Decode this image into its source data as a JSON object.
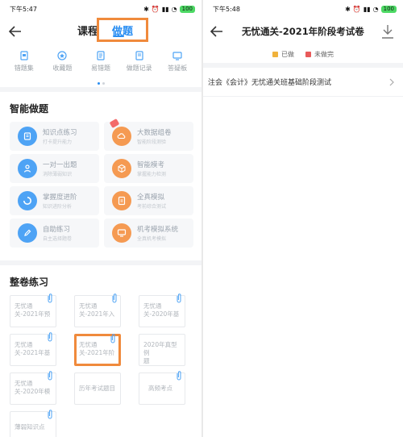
{
  "left": {
    "status": {
      "time": "下午5:47",
      "battery": "100"
    },
    "header": {
      "course_tab": "课程",
      "practice_tab": "做题"
    },
    "quick_items": [
      {
        "label": "错题集",
        "icon": "notebook-icon"
      },
      {
        "label": "收藏题",
        "icon": "star-icon"
      },
      {
        "label": "易错题",
        "icon": "document-icon"
      },
      {
        "label": "做题记录",
        "icon": "record-icon"
      },
      {
        "label": "答疑板",
        "icon": "board-icon"
      }
    ],
    "smart_section": {
      "title": "智能做题",
      "cards": [
        {
          "title": "知识点练习",
          "sub": "打卡提升能力",
          "color": "blue",
          "icon": "book-icon"
        },
        {
          "title": "大数据组卷",
          "sub": "智能阶段测验",
          "color": "orange",
          "icon": "cloud-icon"
        },
        {
          "title": "一对一出题",
          "sub": "消除薄弱知识",
          "color": "blue",
          "icon": "person-icon"
        },
        {
          "title": "智能模考",
          "sub": "掌握能力检测",
          "color": "orange",
          "icon": "cube-icon"
        },
        {
          "title": "掌握度进阶",
          "sub": "知识进阶分析",
          "color": "blue",
          "icon": "progress-icon"
        },
        {
          "title": "全真模拟",
          "sub": "考前综合测试",
          "color": "orange",
          "icon": "paper-icon"
        },
        {
          "title": "自助练习",
          "sub": "自主选择题卷",
          "color": "blue",
          "icon": "pencil-icon"
        },
        {
          "title": "机考模拟系统",
          "sub": "全真机考模拟",
          "color": "orange",
          "icon": "monitor-icon"
        }
      ]
    },
    "paper_section": {
      "title": "整卷练习",
      "papers": [
        {
          "line1": "无忧通",
          "line2": "关-2021年预"
        },
        {
          "line1": "无忧通",
          "line2": "关-2021年入"
        },
        {
          "line1": "无忧通",
          "line2": "关-2020年基"
        },
        {
          "line1": "无忧通",
          "line2": "关-2021年基"
        },
        {
          "line1": "无忧通",
          "line2": "关-2021年阶"
        },
        {
          "line1": "2020年真型例",
          "line2": "题"
        },
        {
          "line1": "无忧通",
          "line2": "关-2020年模"
        },
        {
          "line1": "历年考试题目",
          "line2": ""
        },
        {
          "line1": "高频考点",
          "line2": ""
        },
        {
          "line1": "薄弱知识点",
          "line2": ""
        }
      ]
    }
  },
  "right": {
    "status": {
      "time": "下午5:48",
      "battery": "100"
    },
    "title": "无忧通关-2021年阶段考试卷",
    "legend": {
      "done": "已做",
      "undone": "未做完",
      "done_color": "#f0b23c",
      "undone_color": "#e85a5a"
    },
    "exam_item": "注会《会计》无忧通关班基础阶段测试"
  },
  "colors": {
    "accent": "#2a8ef2",
    "highlight": "#f08a3c",
    "blue_circle": "#4ea3f5",
    "orange_circle": "#f59a52"
  }
}
